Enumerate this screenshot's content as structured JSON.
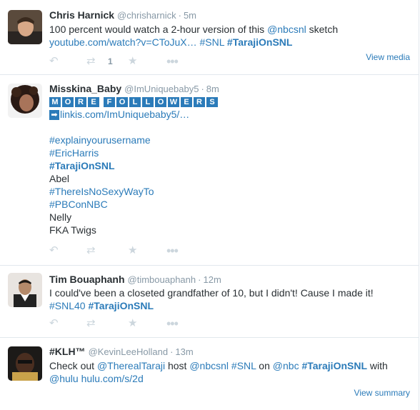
{
  "tweets": [
    {
      "fullname": "Chris Harnick",
      "username": "@chrisharnick",
      "time": "5m",
      "line1_prefix": "100 percent would watch a 2-hour version of this ",
      "line1_mention": "@nbcsnl",
      "line1_suffix": " sketch",
      "link": "youtube.com/watch?v=CToJuX…",
      "tag1": "#SNL",
      "tag2": "#TarajiOnSNL",
      "retweet_count": "1",
      "view_link": "View media"
    },
    {
      "fullname": "Misskina_Baby",
      "username": "@ImUniquebaby5",
      "time": "8m",
      "badge_letters": [
        "M",
        "O",
        "R",
        "E",
        "F",
        "O",
        "L",
        "L",
        "O",
        "W",
        "E",
        "R",
        "S"
      ],
      "arrow_glyph": "➡",
      "link": "linkis.com/ImUniquebaby5/…",
      "lines": [
        "#explainyourusername",
        "#EricHarris",
        "#TarajiOnSNL",
        "Abel",
        "#ThereIsNoSexyWayTo",
        "#PBConNBC",
        "Nelly",
        "FKA Twigs"
      ]
    },
    {
      "fullname": "Tim Bouaphanh",
      "username": "@timbouaphanh",
      "time": "12m",
      "text": "I could've been a closeted grandfather of 10, but I didn't!  Cause I made it!",
      "tag1": "#SNL40",
      "tag2": "#TarajiOnSNL"
    },
    {
      "fullname": "#KLH™",
      "username": "@KevinLeeHolland",
      "time": "13m",
      "w1": "Check out ",
      "m1": "@TherealTaraji",
      "w2": " host ",
      "m2": "@nbcsnl",
      "t1": "#SNL",
      "w3": " on ",
      "m3": "@nbc",
      "t2": "#TarajiOnSNL",
      "w4": " with",
      "m4": "@hulu",
      "link": "hulu.com/s/2d",
      "view_link": "View summary"
    }
  ],
  "icons": {
    "reply": "↶",
    "retweet": "⇄",
    "favorite": "★",
    "more": "•••"
  },
  "colors": {
    "link": "#2b7bb9",
    "muted": "#8899a6",
    "action_icon": "#ccd6dd",
    "divider": "#e1e8ed"
  }
}
